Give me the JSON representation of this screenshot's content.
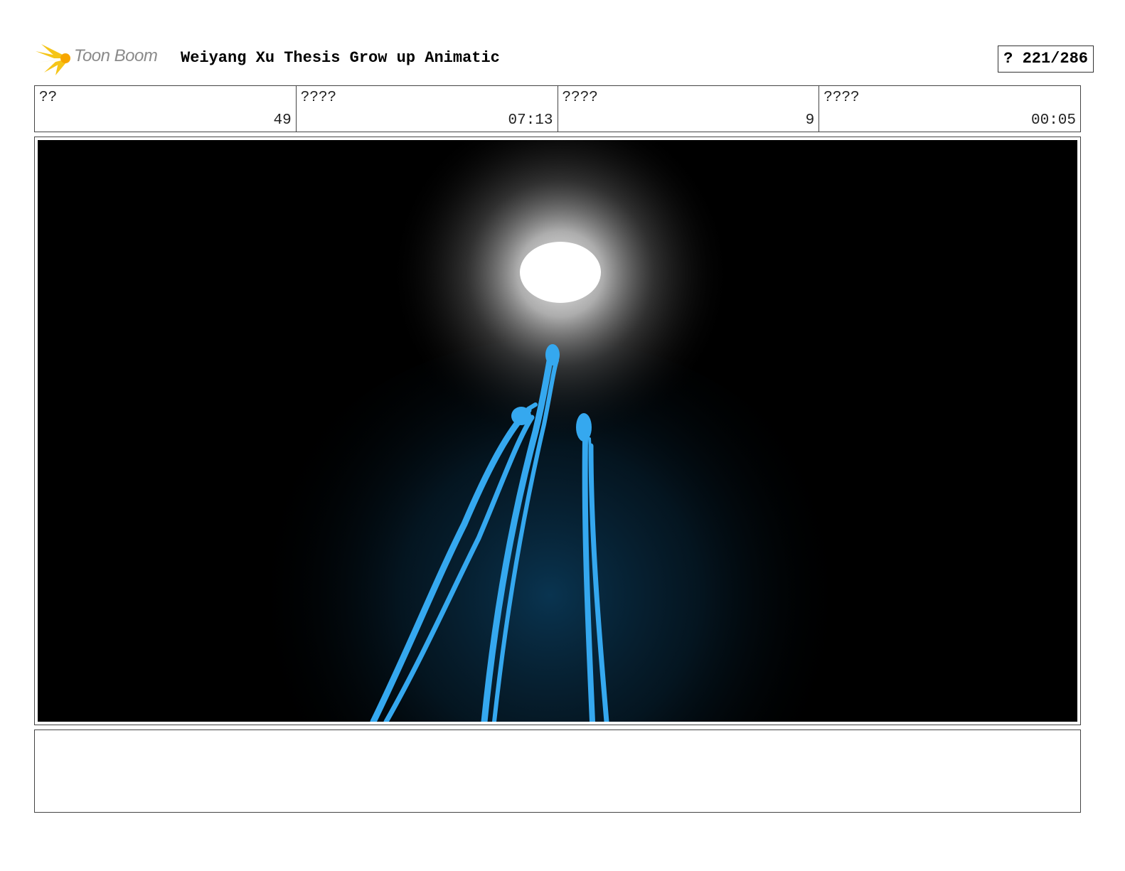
{
  "header": {
    "logo_text": "Toon Boom",
    "project_title": "Weiyang Xu Thesis Grow up Animatic",
    "page_counter": "? 221/286"
  },
  "info": [
    {
      "label": "??",
      "value": "49"
    },
    {
      "label": "????",
      "value": "07:13"
    },
    {
      "label": "????",
      "value": "9"
    },
    {
      "label": "????",
      "value": "00:05"
    }
  ],
  "panel": {
    "description_colors": {
      "background": "#000000",
      "moon": "#ffffff",
      "figures": "#35a8ef"
    }
  },
  "notes": {
    "text": ""
  }
}
